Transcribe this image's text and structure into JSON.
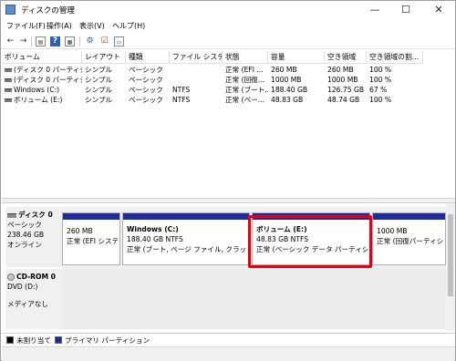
{
  "window": {
    "title": "ディスクの管理",
    "controls": {
      "minimize": "—",
      "maximize": "☐",
      "close": "✕"
    }
  },
  "menu": [
    {
      "label": "ファイル(F)"
    },
    {
      "label": "操作(A)"
    },
    {
      "label": "表示(V)"
    },
    {
      "label": "ヘルプ(H)"
    }
  ],
  "toolbar": {
    "icons": [
      "back-icon",
      "forward-icon",
      "disk-list-icon",
      "help-icon",
      "view-icon",
      "settings-icon",
      "check-icon",
      "properties-icon"
    ]
  },
  "table": {
    "headers": [
      "ボリューム",
      "レイアウト",
      "種類",
      "ファイル システム",
      "状態",
      "容量",
      "空き領域",
      "空き領域の割..."
    ],
    "rows": [
      [
        "(ディスク 0 パーティシ...",
        "シンプル",
        "ベーシック",
        "",
        "正常 (EFI ...",
        "260 MB",
        "260 MB",
        "100 %"
      ],
      [
        "(ディスク 0 パーティシ...",
        "シンプル",
        "ベーシック",
        "",
        "正常 (回復...",
        "1000 MB",
        "1000 MB",
        "100 %"
      ],
      [
        "Windows (C:)",
        "シンプル",
        "ベーシック",
        "NTFS",
        "正常 (ブート...",
        "188.40 GB",
        "126.75 GB",
        "67 %"
      ],
      [
        "ボリューム (E:)",
        "シンプル",
        "ベーシック",
        "NTFS",
        "正常 (ベー...",
        "48.83 GB",
        "48.74 GB",
        "100 %"
      ]
    ]
  },
  "disks": [
    {
      "name": "ディスク 0",
      "type": "ベーシック",
      "size": "238.46 GB",
      "status": "オンライン",
      "partitions": [
        {
          "name": "",
          "size": "260 MB",
          "status": "正常 (EFI システム"
        },
        {
          "name": "Windows (C:)",
          "size": "188.40 GB NTFS",
          "status": "正常 (ブート, ページ ファイル, クラッシュ ダンプ"
        },
        {
          "name": "ボリューム (E:)",
          "size": "48.83 GB NTFS",
          "status": "正常 (ベーシック データ パーティション)"
        },
        {
          "name": "",
          "size": "1000 MB",
          "status": "正常 (回復パーティション)"
        }
      ]
    },
    {
      "name": "CD-ROM 0",
      "type": "DVD (D:)",
      "size": "",
      "status": "メディアなし"
    }
  ],
  "legend": [
    {
      "label": "未割り当て",
      "color": "#000000"
    },
    {
      "label": "プライマリ パーティション",
      "color": "#1f2a9c"
    }
  ],
  "colors": {
    "highlight": "#e60012",
    "partition_bar": "#1f2a9c"
  }
}
